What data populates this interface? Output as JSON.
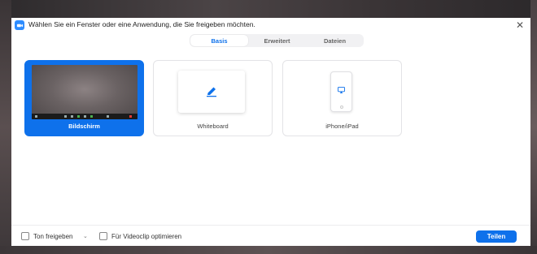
{
  "window": {
    "title": "Wählen Sie ein Fenster oder eine Anwendung, die Sie freigeben möchten.",
    "close_symbol": "✕"
  },
  "tabs": [
    {
      "label": "Basis",
      "active": true
    },
    {
      "label": "Erweitert",
      "active": false
    },
    {
      "label": "Dateien",
      "active": false
    }
  ],
  "sources": [
    {
      "label": "Bildschirm",
      "selected": true,
      "icon": "desktop-thumbnail"
    },
    {
      "label": "Whiteboard",
      "selected": false,
      "icon": "pen-icon"
    },
    {
      "label": "iPhone/iPad",
      "selected": false,
      "icon": "airplay-icon"
    }
  ],
  "footer": {
    "share_sound_label": "Ton freigeben",
    "share_sound_checked": false,
    "dropdown_symbol": "⌄",
    "optimize_video_label": "Für Videoclip optimieren",
    "optimize_video_checked": false,
    "share_button_label": "Teilen"
  },
  "colors": {
    "accent": "#0e71eb",
    "brand": "#2d8cff"
  }
}
